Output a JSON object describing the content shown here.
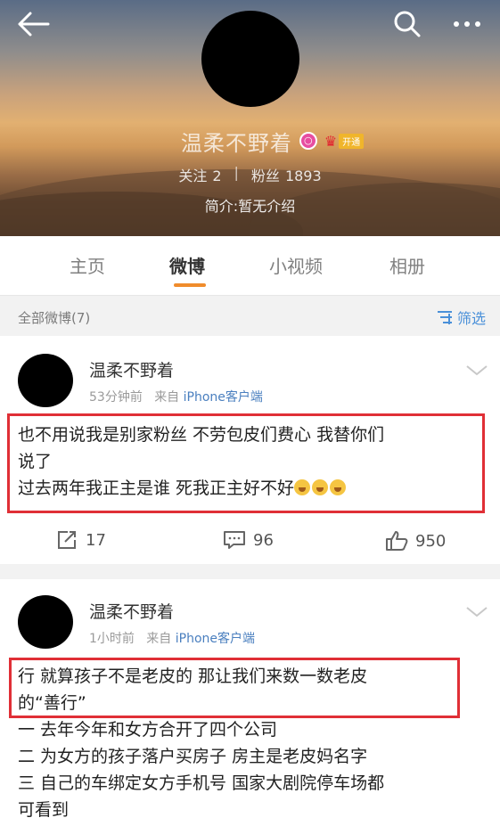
{
  "header": {
    "name": "温柔不野着",
    "badge_char": "○",
    "vip_label": "开通",
    "following_label": "关注",
    "following_count": "2",
    "divider": "|",
    "followers_label": "粉丝",
    "followers_count": "1893",
    "intro": "简介:暂无介绍"
  },
  "tabs": [
    "主页",
    "微博",
    "小视频",
    "相册"
  ],
  "active_tab": "微博",
  "filter": {
    "label": "全部微博(7)",
    "button": "筛选"
  },
  "posts": [
    {
      "author": "温柔不野着",
      "time": "53分钟前",
      "from": "来自",
      "source": "iPhone客户端",
      "lines": [
        "也不用说我是别家粉丝 不劳包皮们费心 我替你们",
        "说了",
        "过去两年我正主是谁 死我正主好不好"
      ],
      "emoji_count": 3,
      "reposts": "17",
      "comments": "96",
      "likes": "950"
    },
    {
      "author": "温柔不野着",
      "time": "1小时前",
      "from": "来自",
      "source": "iPhone客户端",
      "lines": [
        "行 就算孩子不是老皮的 那让我们来数一数老皮",
        "的“善行”",
        "一 去年今年和女方合开了四个公司",
        "二 为女方的孩子落户买房子 房主是老皮妈名字",
        "三 自己的车绑定女方手机号 国家大剧院停车场都",
        "可看到"
      ]
    }
  ],
  "colors": {
    "highlight_border": "#e02f36",
    "tab_indicator": "#f08c2c",
    "link": "#4a90d9"
  }
}
